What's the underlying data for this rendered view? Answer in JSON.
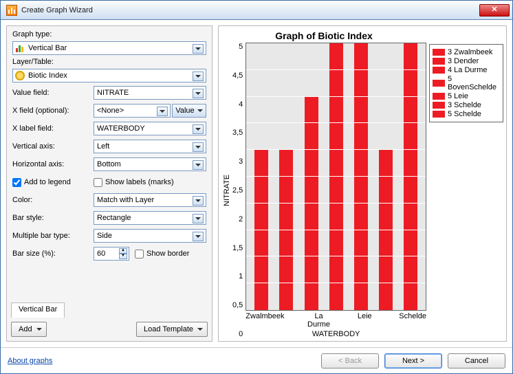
{
  "window": {
    "title": "Create Graph Wizard"
  },
  "labels": {
    "graph_type": "Graph type:",
    "layer_table": "Layer/Table:",
    "value_field": "Value field:",
    "x_field": "X field (optional):",
    "x_label_field": "X label field:",
    "vertical_axis": "Vertical axis:",
    "horizontal_axis": "Horizontal axis:",
    "add_to_legend": "Add to legend",
    "show_labels": "Show labels (marks)",
    "color": "Color:",
    "bar_style": "Bar style:",
    "multi_bar": "Multiple bar type:",
    "bar_size": "Bar size (%):",
    "show_border": "Show border",
    "value_btn": "Value"
  },
  "values": {
    "graph_type": "Vertical Bar",
    "layer_table": "Biotic Index",
    "value_field": "NITRATE",
    "x_field": "<None>",
    "x_label_field": "WATERBODY",
    "vertical_axis": "Left",
    "horizontal_axis": "Bottom",
    "add_to_legend_checked": true,
    "show_labels_checked": false,
    "color": "Match with Layer",
    "bar_style": "Rectangle",
    "multi_bar": "Side",
    "bar_size": "60",
    "show_border_checked": false
  },
  "tab": {
    "label": "Vertical Bar"
  },
  "buttons": {
    "add": "Add",
    "load_template": "Load Template"
  },
  "footer": {
    "about": "About graphs",
    "back": "< Back",
    "next": "Next >",
    "cancel": "Cancel"
  },
  "chart_data": {
    "type": "bar",
    "title": "Graph of Biotic Index",
    "xlabel": "WATERBODY",
    "ylabel": "NITRATE",
    "ylim": [
      0,
      5
    ],
    "yticks": [
      "0",
      "0,5",
      "1",
      "1,5",
      "2",
      "2,5",
      "3",
      "3,5",
      "4",
      "4,5",
      "5"
    ],
    "categories": [
      "Zwalmbeek",
      "Dender",
      "La Durme",
      "BovenSchelde",
      "Leie",
      "Schelde",
      "Schelde"
    ],
    "values": [
      3,
      3,
      4,
      5,
      5,
      3,
      5
    ],
    "x_tick_labels": [
      "Zwalmbeek",
      "",
      "La Durme",
      "",
      "Leie",
      "",
      "Schelde"
    ],
    "legend": [
      "3 Zwalmbeek",
      "3 Dender",
      "4 La Durme",
      "5 BovenSchelde",
      "5 Leie",
      "3 Schelde",
      "5 Schelde"
    ],
    "color": "#ed1c24"
  }
}
